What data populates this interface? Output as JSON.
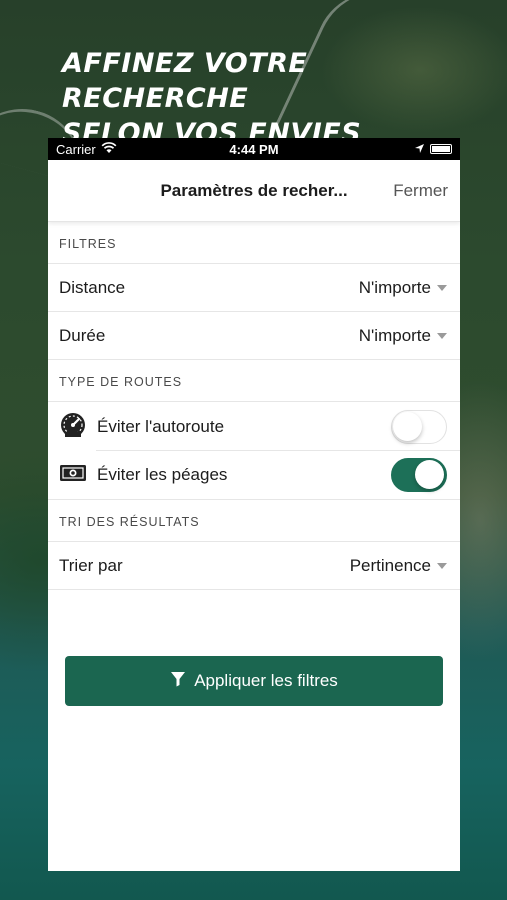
{
  "headline": {
    "line1": "AFFINEZ VOTRE RECHERCHE",
    "line2": "SELON VOS ENVIES"
  },
  "status_bar": {
    "carrier": "Carrier",
    "time": "4:44 PM"
  },
  "navbar": {
    "title": "Paramètres de recher...",
    "close_label": "Fermer"
  },
  "sections": {
    "filters": {
      "header": "FILTRES",
      "distance": {
        "label": "Distance",
        "value": "N'importe"
      },
      "duration": {
        "label": "Durée",
        "value": "N'importe"
      }
    },
    "routes": {
      "header": "TYPE DE ROUTES",
      "avoid_highway": {
        "label": "Éviter l'autoroute",
        "enabled": false,
        "icon": "speedometer-icon"
      },
      "avoid_tolls": {
        "label": "Éviter les péages",
        "enabled": true,
        "icon": "cash-icon"
      }
    },
    "sort": {
      "header": "TRI DES RÉSULTATS",
      "sort_by": {
        "label": "Trier par",
        "value": "Pertinence"
      }
    }
  },
  "apply_button": {
    "label": "Appliquer les filtres",
    "icon": "filter-icon"
  },
  "colors": {
    "accent": "#1b6650",
    "toggle_on": "#1d7058"
  }
}
